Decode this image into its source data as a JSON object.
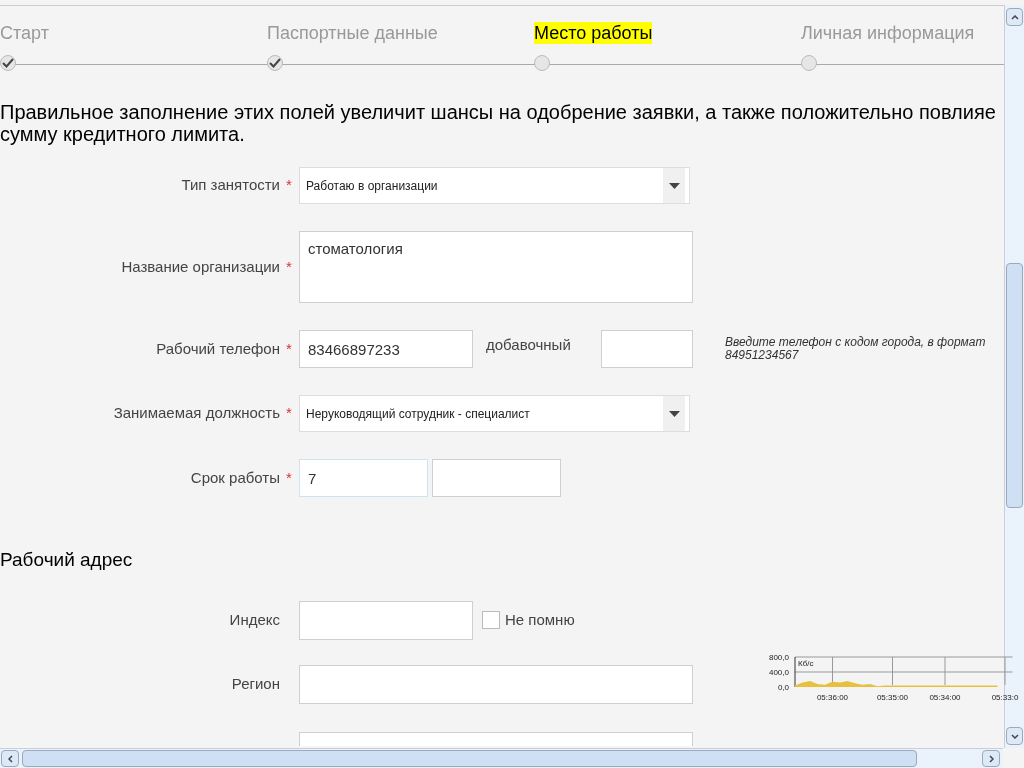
{
  "steps": [
    {
      "label": "Старт",
      "done": true,
      "selected": false
    },
    {
      "label": "Паспортные данные",
      "done": true,
      "selected": false
    },
    {
      "label": "Место работы",
      "done": false,
      "selected": true
    },
    {
      "label": "Личная информация",
      "done": false,
      "selected": false
    }
  ],
  "intro": [
    "Правильное заполнение этих полей увеличит шансы на одобрение заявки, а также положительно повлияе",
    "сумму кредитного лимита."
  ],
  "fields": [
    {
      "kind": "select",
      "label": "Тип занятости",
      "required_mark": "*",
      "value": "Работаю в организации"
    },
    {
      "kind": "textarea",
      "label": "Название организации",
      "required_mark": "*",
      "value": "стоматология"
    },
    {
      "kind": "phone",
      "label": "Рабочий телефон",
      "required_mark": "*",
      "value": "83466897233",
      "extension_label": "добавочный",
      "hint": [
        "Введите телефон с кодом города, в формат",
        "84951234567"
      ]
    },
    {
      "kind": "select",
      "label": "Занимаемая должность",
      "required_mark": "*",
      "value": "Неруководящий сотрудник - специалист"
    },
    {
      "kind": "pair",
      "label": "Срок работы",
      "required_mark": "*",
      "value": "7"
    }
  ],
  "address": {
    "title": "Рабочий адрес",
    "fields": [
      {
        "kind": "index",
        "label": "Индекс",
        "checkbox_label": "Не помню",
        "checked": false
      },
      {
        "kind": "text",
        "label": "Регион"
      }
    ]
  },
  "traffic": {
    "chart_data": {
      "type": "area",
      "grid": true,
      "ref_lines": [
        {
          "axis": "y",
          "value": 400
        }
      ],
      "ylabel": "Кб/с",
      "categories": [
        null,
        null,
        null,
        null,
        null,
        "05:36:00",
        null,
        null,
        null,
        null,
        null,
        null,
        null,
        "05:35:00",
        null,
        null,
        null,
        null,
        null,
        null,
        "05:34:00",
        null,
        null,
        null,
        null,
        null,
        null,
        null,
        "05:33:0",
        null
      ],
      "yticks": [
        {
          "value": 0,
          "label": "0,0"
        },
        {
          "value": 400,
          "label": "400,0"
        },
        {
          "value": 800,
          "label": "800,0"
        }
      ],
      "ylim": [
        0,
        800
      ],
      "series": [
        {
          "color": "#e8c040",
          "values": [
            40,
            120,
            160,
            80,
            60,
            140,
            120,
            160,
            100,
            60,
            80,
            20,
            40,
            40,
            40,
            40,
            40,
            40,
            40,
            40,
            40,
            40,
            40,
            40,
            40,
            40,
            40,
            40,
            null,
            null
          ]
        }
      ]
    }
  }
}
